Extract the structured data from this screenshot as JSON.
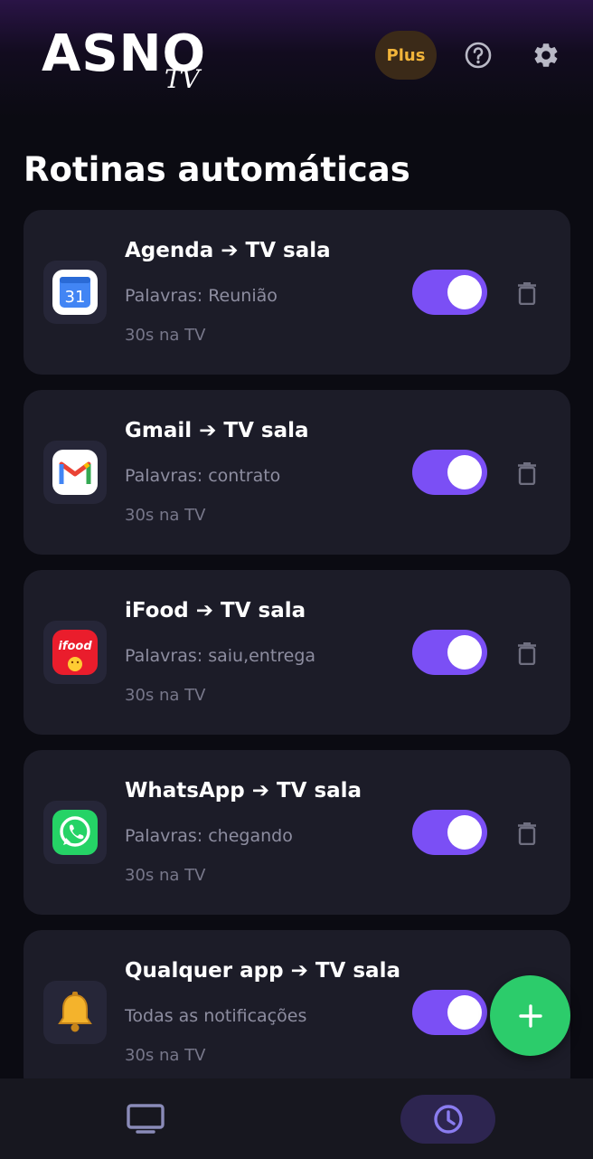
{
  "app": {
    "logo_main": "ASNO",
    "logo_sub": "TV",
    "plus_label": "Plus"
  },
  "icons": {
    "help": "help-circle-icon",
    "settings": "gear-icon",
    "delete": "trash-icon",
    "add": "plus-icon",
    "tv": "tv-icon",
    "routines": "clock-icon"
  },
  "colors": {
    "accent": "#7b4ff5",
    "plus_text": "#f2b53a",
    "fab": "#2ccc6b",
    "card": "#1c1c28"
  },
  "page_title": "Rotinas automáticas",
  "routines": [
    {
      "app": "Agenda",
      "arrow": "➔",
      "target": "TV sala",
      "keywords": "Palavras: Reunião",
      "duration": "30s na TV",
      "icon": "calendar-icon",
      "icon_text": "31",
      "enabled": true
    },
    {
      "app": "Gmail",
      "arrow": "➔",
      "target": "TV sala",
      "keywords": "Palavras: contrato",
      "duration": "30s na TV",
      "icon": "gmail-icon",
      "enabled": true
    },
    {
      "app": "iFood",
      "arrow": "➔",
      "target": "TV sala",
      "keywords": "Palavras: saiu,entrega",
      "duration": "30s na TV",
      "icon": "ifood-icon",
      "icon_text": "ifood",
      "enabled": true
    },
    {
      "app": "WhatsApp",
      "arrow": "➔",
      "target": "TV sala",
      "keywords": "Palavras: chegando",
      "duration": "30s na TV",
      "icon": "whatsapp-icon",
      "enabled": true
    },
    {
      "app": "Qualquer app",
      "arrow": "➔",
      "target": "TV sala",
      "keywords": "Todas as notificações",
      "duration": "30s na TV",
      "icon": "bell-icon",
      "icon_text": "🔔",
      "enabled": true
    }
  ]
}
